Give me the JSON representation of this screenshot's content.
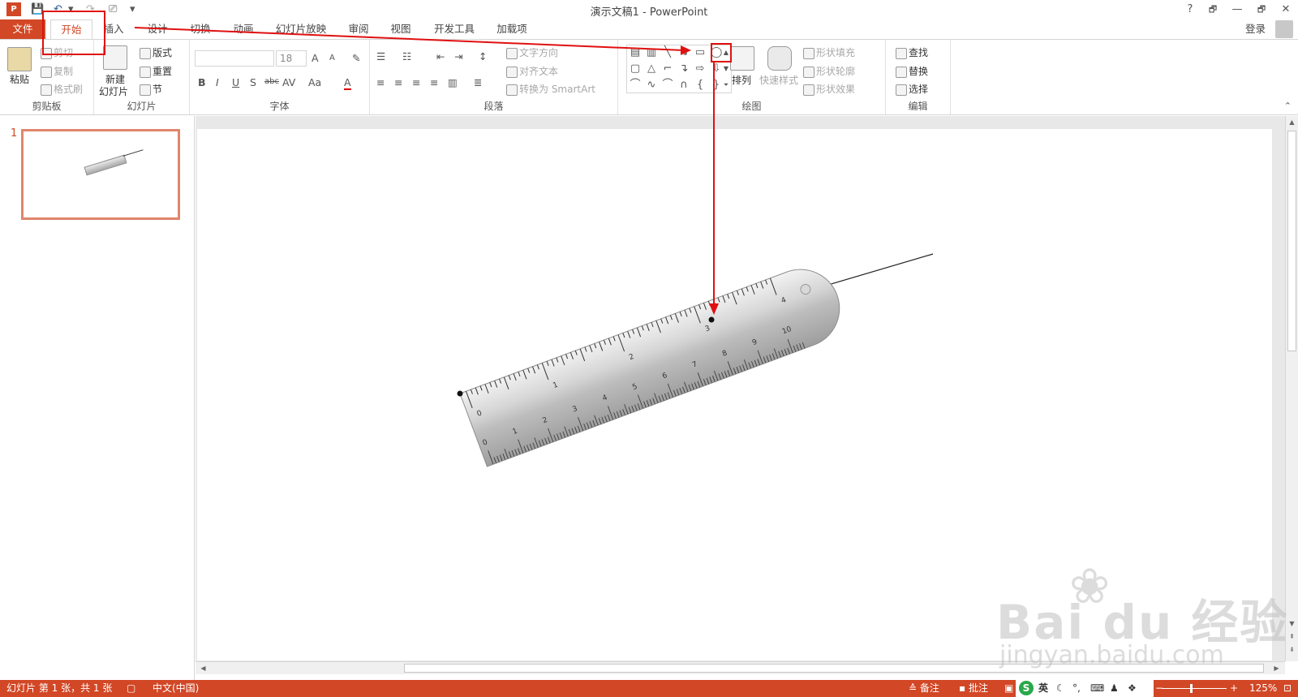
{
  "app": {
    "logo": "P",
    "window_title": "演示文稿1 - PowerPoint",
    "help": "?",
    "minimize": "—",
    "restore": "🗗",
    "close": "✕"
  },
  "qat": {
    "save": "💾",
    "undo": "↶",
    "redo": "↷",
    "present": "⎚",
    "customize": "▾"
  },
  "tabs": [
    {
      "label": "文件"
    },
    {
      "label": "开始"
    },
    {
      "label": "插入"
    },
    {
      "label": "设计"
    },
    {
      "label": "切换"
    },
    {
      "label": "动画"
    },
    {
      "label": "幻灯片放映"
    },
    {
      "label": "审阅"
    },
    {
      "label": "视图"
    },
    {
      "label": "开发工具"
    },
    {
      "label": "加载项"
    }
  ],
  "account": {
    "login": "登录"
  },
  "ribbon": {
    "clipboard": {
      "label": "剪贴板",
      "paste": "粘贴",
      "cut": "剪切",
      "copy": "复制",
      "format_painter": "格式刷"
    },
    "slides": {
      "label": "幻灯片",
      "new_slide": "新建",
      "new_slide2": "幻灯片",
      "layout": "版式",
      "reset": "重置",
      "section": "节"
    },
    "font": {
      "label": "字体",
      "font_name": "",
      "font_size": "18",
      "bold": "B",
      "italic": "I",
      "underline": "U",
      "shadow": "S",
      "strike": "abc",
      "spacing": "AV",
      "case": "Aa",
      "color": "A",
      "grow": "A",
      "shrink": "A"
    },
    "paragraph": {
      "label": "段落",
      "text_direction": "文字方向",
      "align_text": "对齐文本",
      "smartart": "转换为 SmartArt"
    },
    "drawing": {
      "label": "绘图",
      "arrange": "排列",
      "quick_styles": "快速样式",
      "shape_fill": "形状填充",
      "shape_outline": "形状轮廓",
      "shape_effects": "形状效果"
    },
    "editing": {
      "label": "编辑",
      "find": "查找",
      "replace": "替换",
      "select": "选择"
    }
  },
  "thumbnails": [
    {
      "number": "1"
    }
  ],
  "status": {
    "slide_info": "幻灯片 第 1 张，共 1 张",
    "language": "中文(中国)",
    "notes": "备注",
    "comments": "批注",
    "zoom": "125%",
    "ime_logo": "S",
    "ime_lang": "英"
  },
  "ruler": {
    "top_labels": [
      "0",
      "1",
      "2",
      "3",
      "4"
    ],
    "bottom_labels": [
      "0",
      "1",
      "2",
      "3",
      "4",
      "5",
      "6",
      "7",
      "8",
      "9",
      "10"
    ]
  },
  "watermark": {
    "brand": "Bai du 经验",
    "url": "jingyan.baidu.com"
  },
  "colors": {
    "accent": "#d24726",
    "annotation": "#e01010"
  }
}
